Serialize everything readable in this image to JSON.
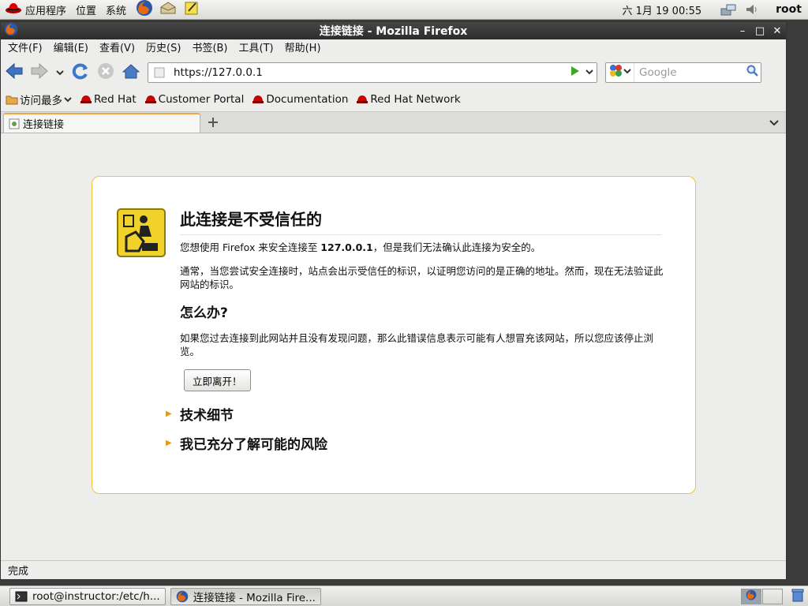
{
  "top_panel": {
    "applications": "应用程序",
    "places": "位置",
    "system": "系统",
    "clock": "六 1月 19 00:55",
    "user": "root"
  },
  "window": {
    "title": "连接链接 - Mozilla Firefox"
  },
  "menubar": {
    "items": [
      "文件(F)",
      "编辑(E)",
      "查看(V)",
      "历史(S)",
      "书签(B)",
      "工具(T)",
      "帮助(H)"
    ]
  },
  "navbar": {
    "url": "https://127.0.0.1",
    "search_placeholder": "Google"
  },
  "bookmarks": {
    "items": [
      "访问最多",
      "Red Hat",
      "Customer Portal",
      "Documentation",
      "Red Hat Network"
    ]
  },
  "tabs": [
    {
      "label": "连接链接"
    }
  ],
  "error_page": {
    "title": "此连接是不受信任的",
    "intro_prefix": "您想使用 Firefox 来安全连接至 ",
    "host": "127.0.0.1",
    "intro_suffix": "，但是我们无法确认此连接为安全的。",
    "explanation": "通常，当您尝试安全连接时，站点会出示受信任的标识，以证明您访问的是正确的地址。然而，现在无法验证此网站的标识。",
    "what_to_do_heading": "怎么办?",
    "what_to_do_text": "如果您过去连接到此网站并且没有发现问题，那么此错误信息表示可能有人想冒充该网站，所以您应该停止浏览。",
    "leave_button": "立即离开！",
    "technical_details": "技术细节",
    "understand_risks": "我已充分了解可能的风险"
  },
  "statusbar": {
    "text": "完成"
  },
  "taskbar": {
    "tasks": [
      "root@instructor:/etc/h...",
      "连接链接 - Mozilla Fire..."
    ]
  },
  "colors": {
    "accent_orange": "#f2a44a",
    "error_border": "#f2c037",
    "panel_bg": "#dcdcd8"
  }
}
